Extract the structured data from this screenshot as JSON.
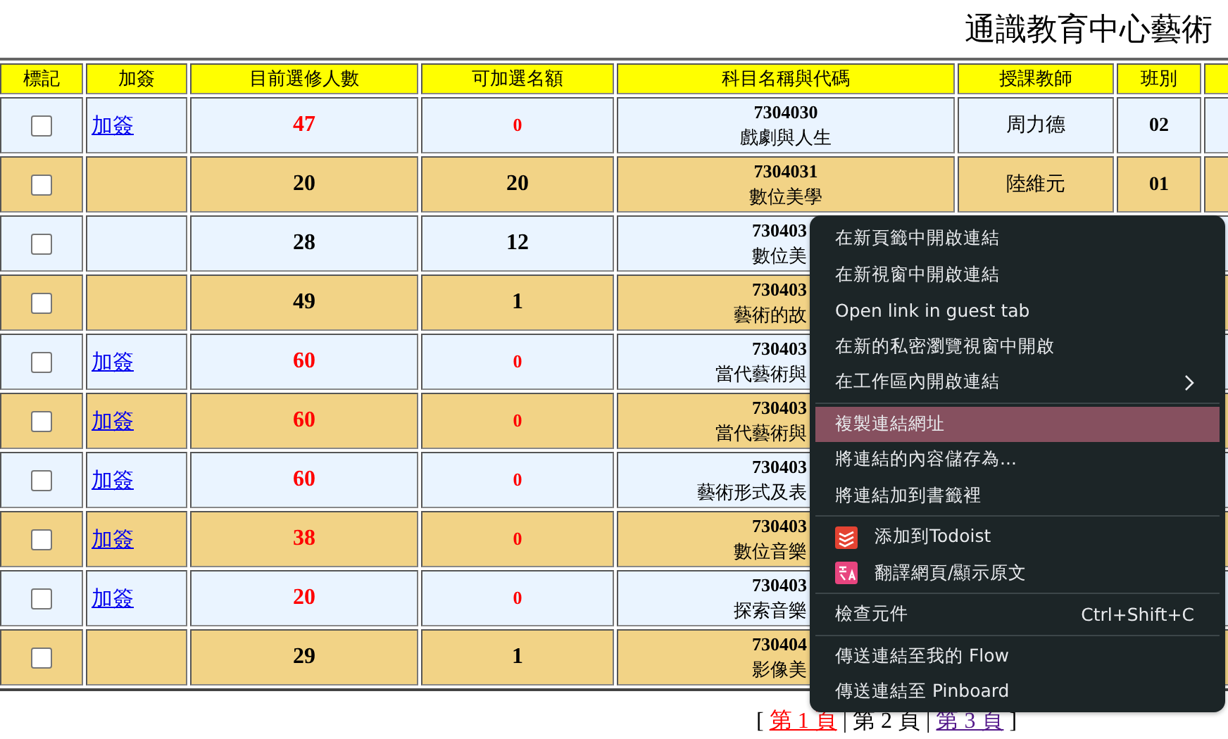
{
  "page_title": "通識教育中心藝術",
  "table": {
    "columns": [
      "標記",
      "加簽",
      "目前選修人數",
      "可加選名額",
      "科目名稱與代碼",
      "授課教師",
      "班別",
      ""
    ],
    "rows": [
      {
        "checked": false,
        "add_link": "加簽",
        "enrolled": "47",
        "quota": "0",
        "full": true,
        "code": "7304030",
        "name": "戲劇與人生",
        "teacher": "周力德",
        "class": "02"
      },
      {
        "checked": false,
        "enrolled": "20",
        "quota": "20",
        "full": false,
        "code": "7304031",
        "name": "數位美學",
        "teacher": "陸維元",
        "class": "01"
      },
      {
        "checked": false,
        "enrolled": "28",
        "quota": "12",
        "full": false,
        "code": "730403",
        "name": "數位美"
      },
      {
        "checked": false,
        "enrolled": "49",
        "quota": "1",
        "full": false,
        "code": "730403",
        "name": "藝術的故"
      },
      {
        "checked": false,
        "add_link": "加簽",
        "enrolled": "60",
        "quota": "0",
        "full": true,
        "code": "730403",
        "name": "當代藝術與"
      },
      {
        "checked": false,
        "add_link": "加簽",
        "enrolled": "60",
        "quota": "0",
        "full": true,
        "code": "730403",
        "name": "當代藝術與"
      },
      {
        "checked": false,
        "add_link": "加簽",
        "enrolled": "60",
        "quota": "0",
        "full": true,
        "code": "730403",
        "name": "藝術形式及表"
      },
      {
        "checked": false,
        "add_link": "加簽",
        "enrolled": "38",
        "quota": "0",
        "full": true,
        "code": "730403",
        "name": "數位音樂"
      },
      {
        "checked": false,
        "add_link": "加簽",
        "enrolled": "20",
        "quota": "0",
        "full": true,
        "code": "730403",
        "name": "探索音樂"
      },
      {
        "checked": false,
        "enrolled": "29",
        "quota": "1",
        "full": false,
        "code": "730404",
        "name": "影像美"
      }
    ]
  },
  "pagination": [
    {
      "kind": "text",
      "text": "["
    },
    {
      "kind": "link",
      "text": "第 1 頁",
      "selected": false,
      "color": "#ff0000"
    },
    {
      "kind": "text",
      "text": "|"
    },
    {
      "kind": "link",
      "text": "第 2 頁",
      "selected": true,
      "color": "#000000"
    },
    {
      "kind": "text",
      "text": "|"
    },
    {
      "kind": "link",
      "text": "第 3 頁",
      "selected": false,
      "color": "#551a8b"
    },
    {
      "kind": "text",
      "text": "]"
    }
  ],
  "context_menu": {
    "items": [
      {
        "kind": "item",
        "label": "在新頁籤中開啟連結",
        "selected": false
      },
      {
        "kind": "item",
        "label": "在新視窗中開啟連結",
        "selected": false
      },
      {
        "kind": "item",
        "label": "Open link in guest tab",
        "selected": false
      },
      {
        "kind": "item",
        "label": "在新的私密瀏覽視窗中開啟",
        "selected": false
      },
      {
        "kind": "item",
        "label": "在工作區內開啟連結",
        "selected": false,
        "submenu": true
      },
      {
        "kind": "separator"
      },
      {
        "kind": "item",
        "label": "複製連結網址",
        "selected": true
      },
      {
        "kind": "item",
        "label": "將連結的內容儲存為...",
        "selected": false
      },
      {
        "kind": "item",
        "label": "將連結加到書籤裡",
        "selected": false
      },
      {
        "kind": "separator"
      },
      {
        "kind": "todoist",
        "label": "添加到Todoist",
        "selected": false
      },
      {
        "kind": "translate",
        "label": "翻譯網頁/顯示原文",
        "selected": false
      },
      {
        "kind": "separator"
      },
      {
        "kind": "item",
        "label": "檢查元件",
        "selected": false,
        "shortcut": "Ctrl+Shift+C"
      },
      {
        "kind": "separator"
      },
      {
        "kind": "item",
        "label": "傳送連結至我的 Flow",
        "selected": false
      },
      {
        "kind": "item",
        "label": "傳送連結至 Pinboard",
        "selected": false
      }
    ]
  }
}
